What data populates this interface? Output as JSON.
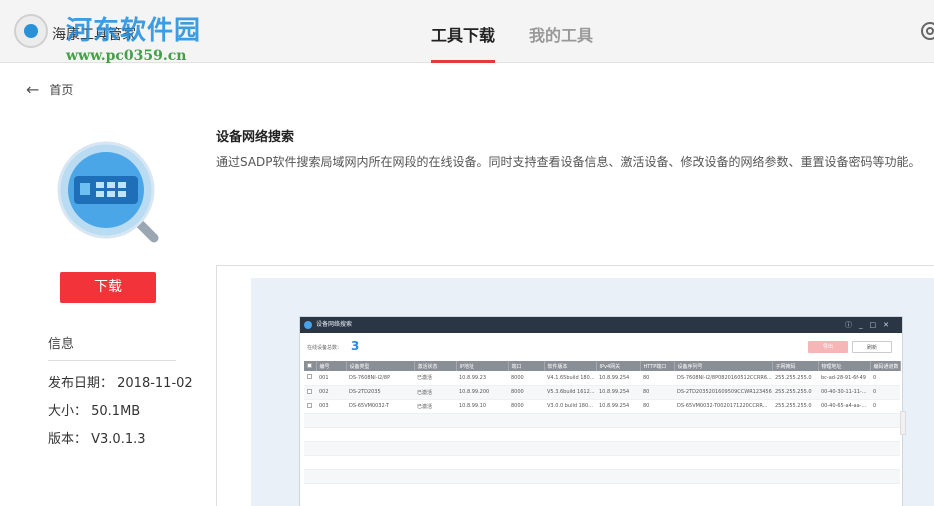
{
  "app": {
    "title": "海康工具管家",
    "watermark_text": "河东软件园",
    "watermark_url": "www.pc0359.cn"
  },
  "tabs": [
    {
      "label": "工具下载",
      "active": true
    },
    {
      "label": "我的工具",
      "active": false
    }
  ],
  "breadcrumb": {
    "label": "首页"
  },
  "tool": {
    "name": "设备网络搜索",
    "description": "通过SADP软件搜索局域网内所在网段的在线设备。同时支持查看设备信息、激活设备、修改设备的网络参数、重置设备密码等功能。",
    "download_label": "下载",
    "info_title": "信息",
    "publish_date": "发布日期： 2018-11-02",
    "size": "大小： 50.1MB",
    "version": "版本： V3.0.1.3"
  },
  "preview": {
    "window_title": "设备网络搜索",
    "count_label": "在线设备总数：",
    "count_value": "3",
    "export_label": "导出",
    "refresh_label": "刷新",
    "columns": [
      "",
      "编号",
      "设备类型",
      "激活状态",
      "IP地址",
      "端口",
      "软件版本",
      "IPv4网关",
      "HTTP端口",
      "设备序列号",
      "子网掩码",
      "物理地址",
      "编码通道数"
    ],
    "rows": [
      [
        "001",
        "DS-7608NI-I2/8P",
        "已激活",
        "10.8.99.23",
        "8000",
        "V4.1.65build 180...",
        "10.8.99.254",
        "80",
        "DS-7608NI-I2/8P0820160512CCRR6...",
        "255.255.255.0",
        "bc-ad-28-91-6f-49",
        "0"
      ],
      [
        "002",
        "DS-2TD2035",
        "已激活",
        "10.8.99.200",
        "8000",
        "V5.3.6build 1612...",
        "10.8.99.254",
        "80",
        "DS-2TD2035201609509CCWR123456...",
        "255.255.255.0",
        "00-40-30-11-11-...",
        "0"
      ],
      [
        "003",
        "DS-65VM0032-T",
        "已激活",
        "10.8.99.10",
        "8000",
        "V3.0.0 build 180...",
        "10.8.99.254",
        "80",
        "DS-65VM0032-T0020171220CCRR...",
        "255.255.255.0",
        "00-40-65-a4-aa-...",
        "0"
      ]
    ]
  },
  "colors": {
    "accent": "#e8383d",
    "download_button": "#f2343a",
    "count_blue": "#2a8ae0"
  }
}
